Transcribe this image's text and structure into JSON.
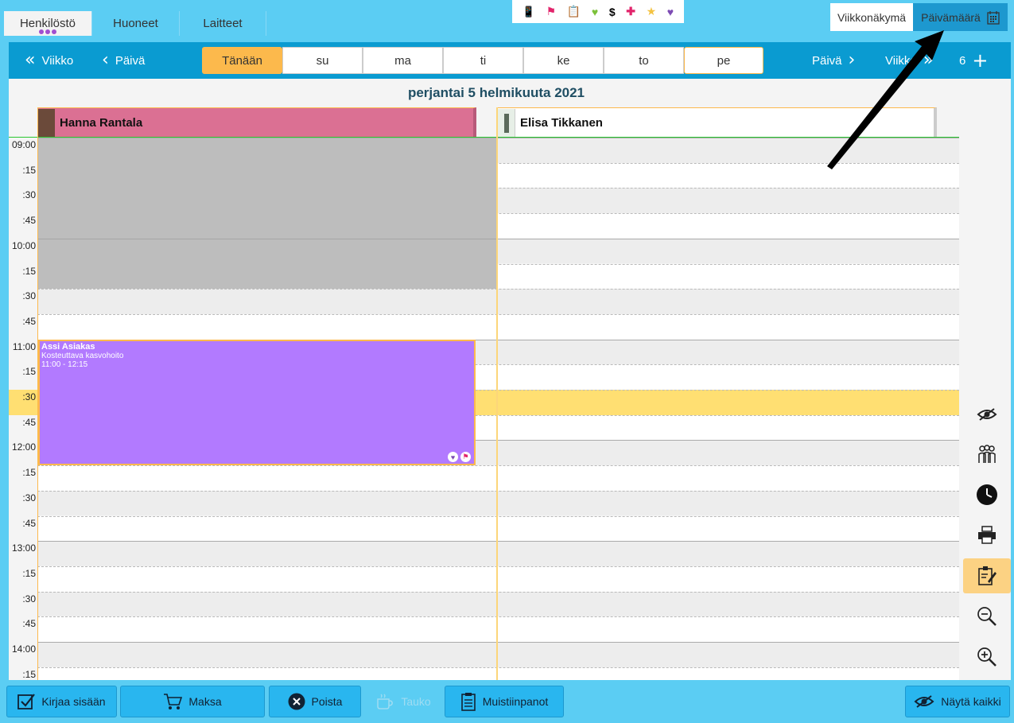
{
  "tabs": [
    {
      "label": "Henkilöstö"
    },
    {
      "label": "Huoneet"
    },
    {
      "label": "Laitteet"
    }
  ],
  "view_toggle": {
    "week": "Viikkonäkymä",
    "day": "Päivämäärä"
  },
  "nav": {
    "prev_week": "Viikko",
    "prev_day": "Päivä",
    "today": "Tänään",
    "days": [
      "su",
      "ma",
      "ti",
      "ke",
      "to",
      "pe"
    ],
    "next_day": "Päivä",
    "next_week": "Viikko",
    "column_count": "6"
  },
  "date_title": "perjantai 5 helmikuuta 2021",
  "staff": [
    {
      "name": "Hanna Rantala",
      "color": "#db7093"
    },
    {
      "name": "Elisa  Tikkanen",
      "color": "#ffffff"
    }
  ],
  "time_labels": [
    "09:00",
    ":15",
    ":30",
    ":45",
    "10:00",
    ":15",
    ":30",
    ":45",
    "11:00",
    ":15",
    ":30",
    ":45",
    "12:00",
    ":15",
    ":30",
    ":45",
    "13:00",
    ":15",
    ":30",
    ":45",
    "14:00",
    ":15"
  ],
  "appointment": {
    "client": "Assi Asiakas",
    "service": "Kosteuttava kasvohoito",
    "time": "11:00 - 12:15",
    "color": "#b27aff"
  },
  "bottom_actions": {
    "checkin": "Kirjaa sisään",
    "pay": "Maksa",
    "delete": "Poista",
    "break": "Tauko",
    "notes": "Muistiinpanot",
    "show_all": "Näytä kaikki"
  },
  "colors": {
    "accent": "#fcb94c",
    "nav": "#0a9bd1",
    "bar": "#5bcdf3",
    "highlight": "#ffdf72"
  }
}
